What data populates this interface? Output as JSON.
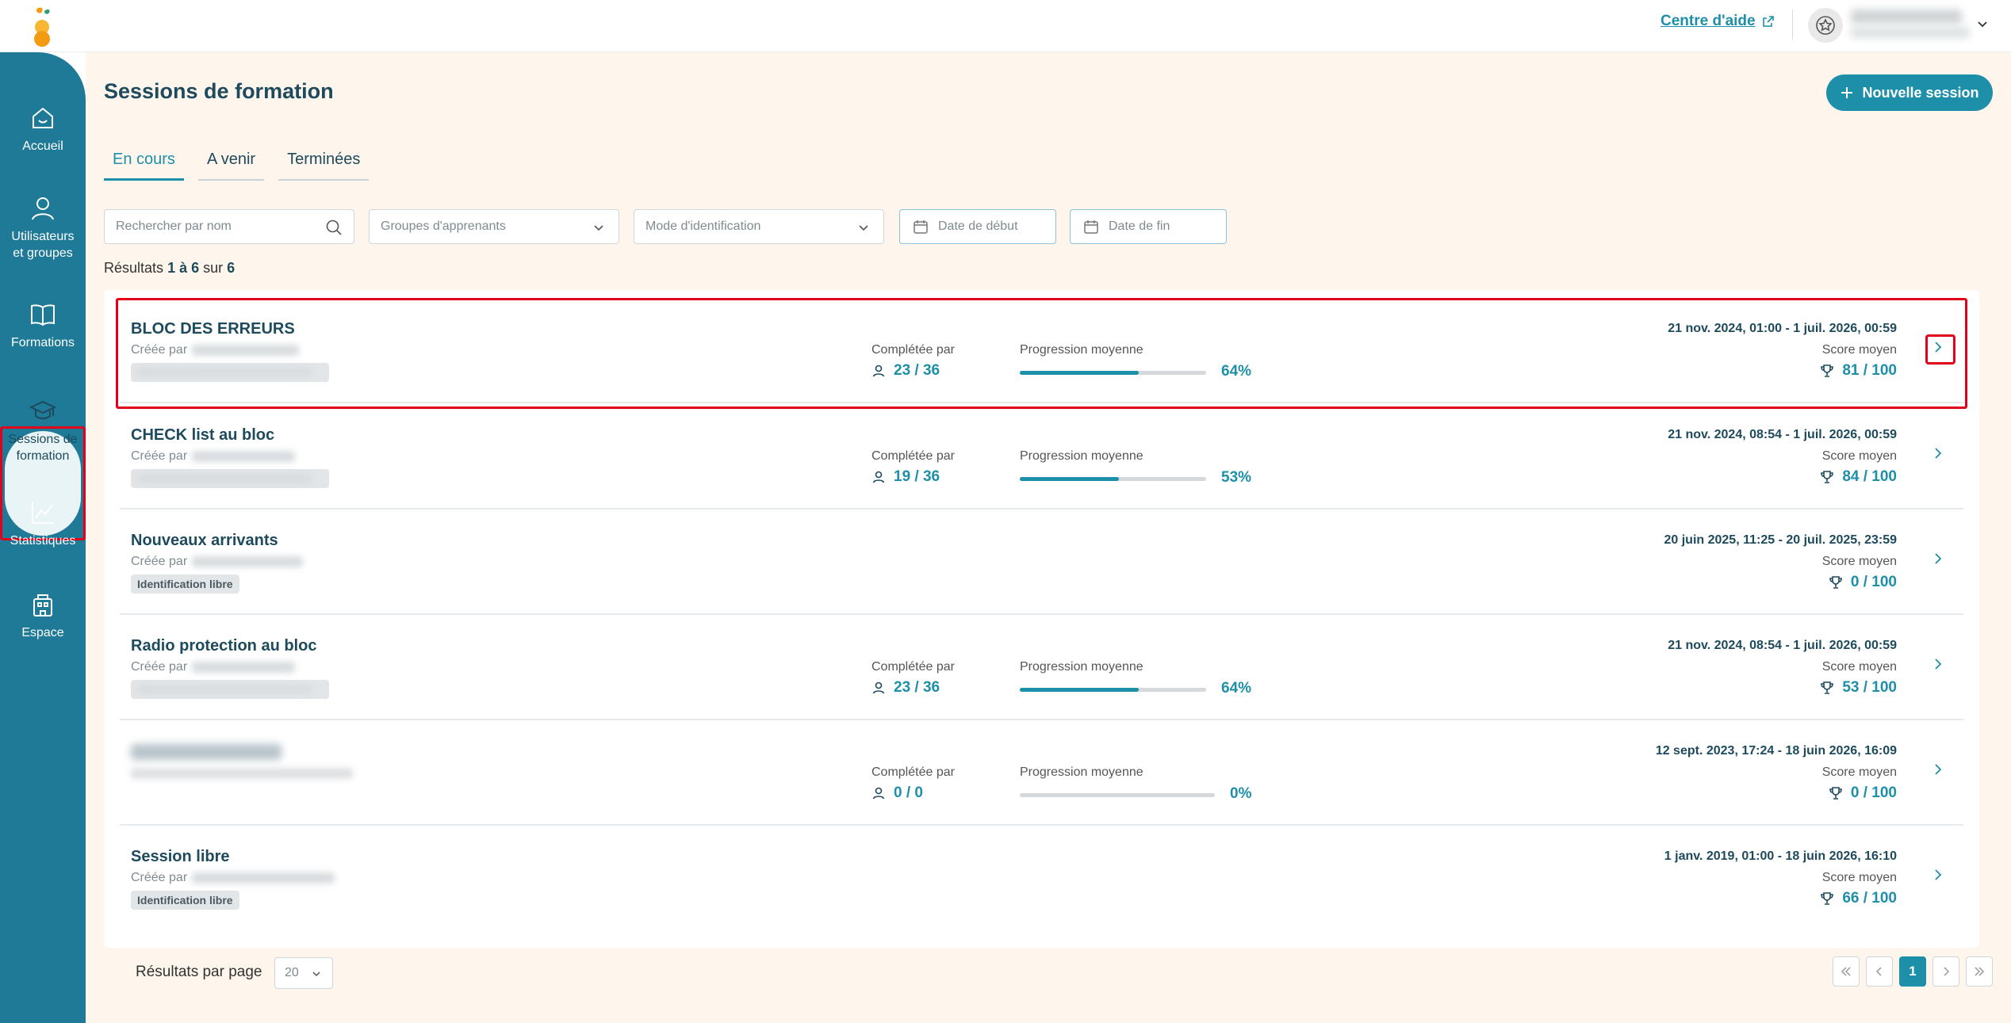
{
  "header": {
    "help_label": "Centre d'aide"
  },
  "sidebar": {
    "items": [
      {
        "label": "Accueil",
        "icon": "home-icon"
      },
      {
        "label": "Utilisateurs\net groupes",
        "icon": "user-icon"
      },
      {
        "label": "Formations",
        "icon": "book-icon"
      },
      {
        "label": "Sessions de\nformation",
        "icon": "graduation-cap-icon"
      },
      {
        "label": "Statistiques",
        "icon": "chart-line-icon"
      },
      {
        "label": "Espace",
        "icon": "building-icon"
      }
    ]
  },
  "page": {
    "title": "Sessions de formation",
    "new_button": "Nouvelle session"
  },
  "tabs": [
    "En cours",
    "A venir",
    "Terminées"
  ],
  "filters": {
    "search_placeholder": "Rechercher par nom",
    "groups_placeholder": "Groupes d'apprenants",
    "ident_placeholder": "Mode d'identification",
    "start_placeholder": "Date de début",
    "end_placeholder": "Date de fin"
  },
  "results": {
    "prefix": "Résultats",
    "range": "1 à 6",
    "of": "sur",
    "total": "6"
  },
  "labels": {
    "created_by": "Créée par",
    "completed_by": "Complétée par",
    "avg_progress": "Progression moyenne",
    "avg_score": "Score moyen"
  },
  "sessions": [
    {
      "name": "BLOC DES ERREURS",
      "dates": "21 nov. 2024, 01:00 - 1 juil. 2026, 00:59",
      "completed": "23 / 36",
      "progress_pct": 64,
      "progress_label": "64%",
      "score": "81 / 100"
    },
    {
      "name": "CHECK list au bloc",
      "dates": "21 nov. 2024, 08:54 - 1 juil. 2026, 00:59",
      "completed": "19 / 36",
      "progress_pct": 53,
      "progress_label": "53%",
      "score": "84 / 100"
    },
    {
      "name": "Nouveaux arrivants",
      "dates": "20 juin 2025, 11:25 - 20 juil. 2025, 23:59",
      "badge": "Identification libre",
      "score": "0 / 100"
    },
    {
      "name": "Radio protection au bloc",
      "dates": "21 nov. 2024, 08:54 - 1 juil. 2026, 00:59",
      "completed": "23 / 36",
      "progress_pct": 64,
      "progress_label": "64%",
      "score": "53 / 100"
    },
    {
      "dates": "12 sept. 2023, 17:24 - 18 juin 2026, 16:09",
      "completed": "0 / 0",
      "progress_pct": 0,
      "progress_label": "0%",
      "score": "0 / 100"
    },
    {
      "name": "Session libre",
      "dates": "1 janv. 2019, 01:00 - 18 juin 2026, 16:10",
      "badge": "Identification libre",
      "score": "66 / 100"
    }
  ],
  "pagination": {
    "per_page_label": "Résultats par page",
    "per_page_value": "20",
    "current_page": "1"
  },
  "colors": {
    "primary": "#1e8fa8",
    "sidebar": "#1e7a96",
    "background": "#fef5ec",
    "highlight": "#e3001b"
  }
}
